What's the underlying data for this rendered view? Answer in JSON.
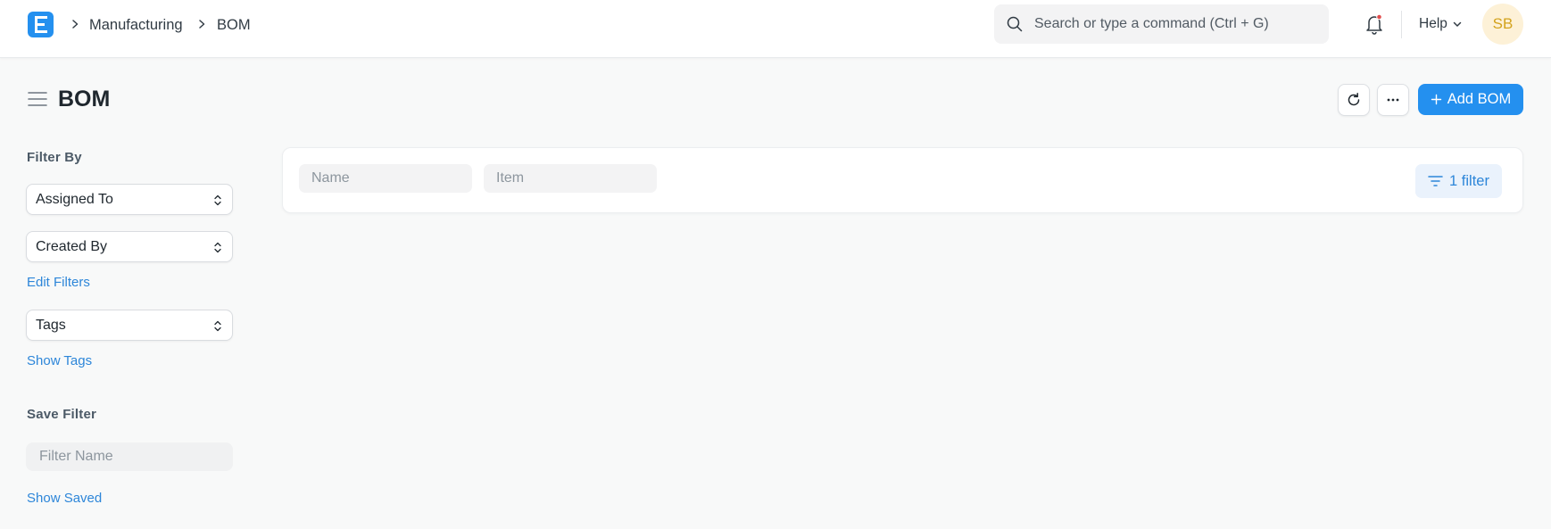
{
  "navbar": {
    "breadcrumbs": [
      "Manufacturing",
      "BOM"
    ],
    "search_placeholder": "Search or type a command (Ctrl + G)",
    "help_label": "Help",
    "avatar_initials": "SB"
  },
  "page": {
    "title": "BOM",
    "add_button_label": "Add BOM",
    "more_button_label": "···"
  },
  "sidebar": {
    "filter_by_label": "Filter By",
    "assigned_to": "Assigned To",
    "created_by": "Created By",
    "edit_filters": "Edit Filters",
    "tags": "Tags",
    "show_tags": "Show Tags",
    "save_filter_label": "Save Filter",
    "filter_name_placeholder": "Filter Name",
    "show_saved": "Show Saved"
  },
  "list": {
    "name_placeholder": "Name",
    "item_placeholder": "Item",
    "filter_button_label": "1 filter"
  },
  "colors": {
    "primary": "#2490ef",
    "link": "#2d86d9",
    "avatar_bg": "#fdf1d7",
    "avatar_text": "#d3a21c",
    "notification_dot": "#e24c4c"
  }
}
